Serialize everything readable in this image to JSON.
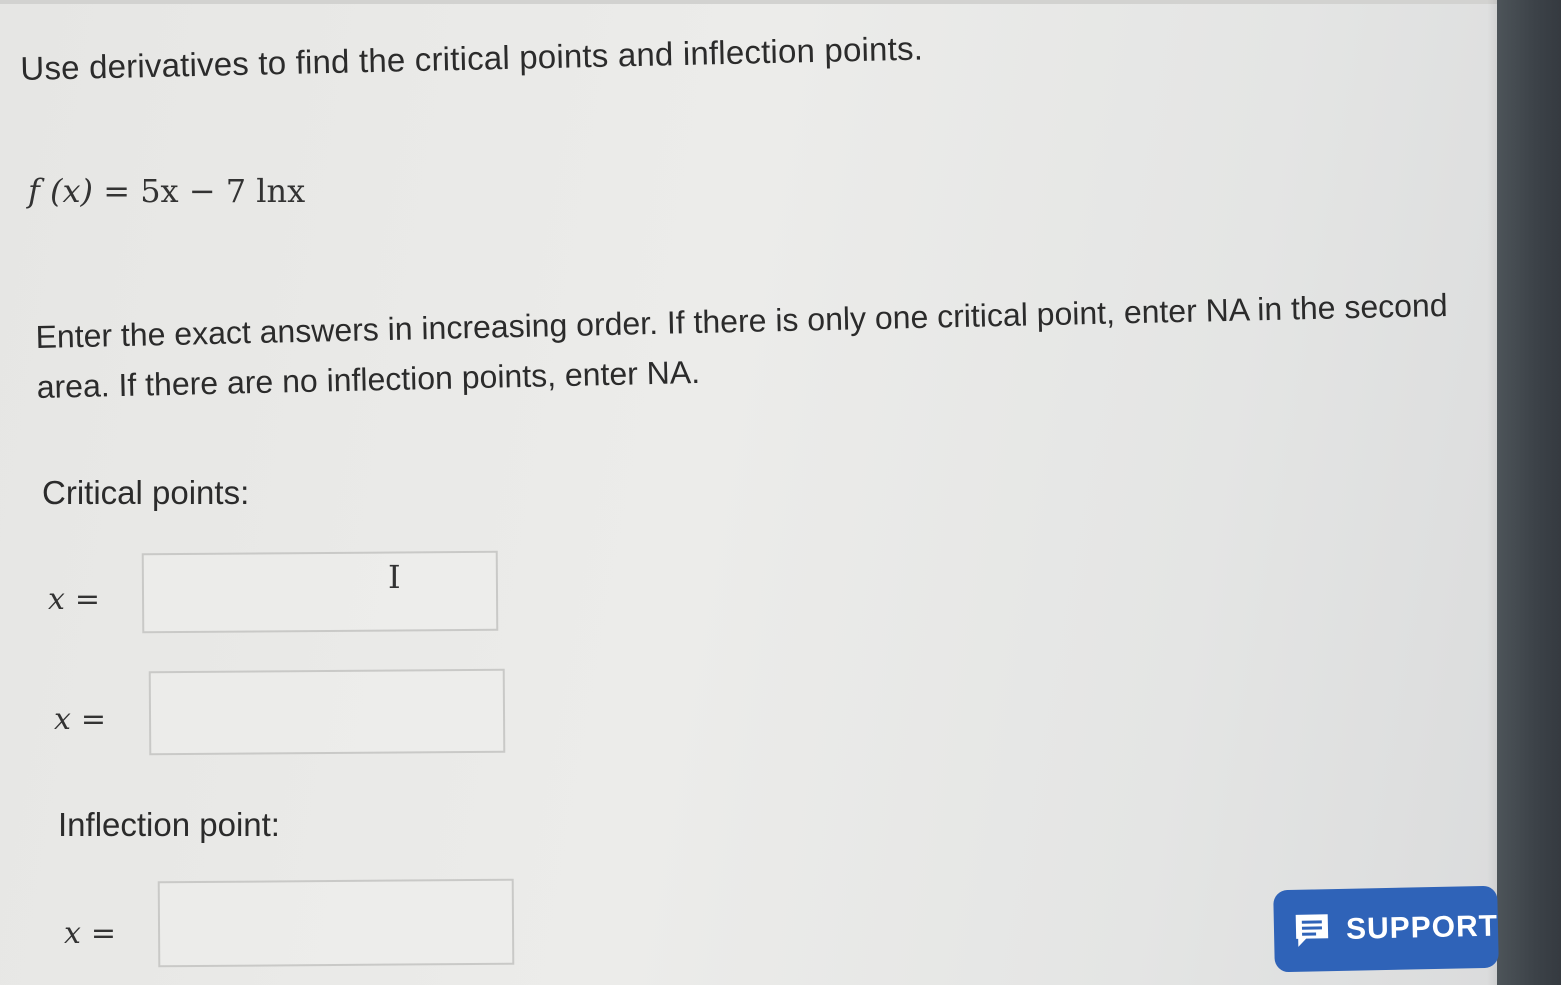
{
  "question": {
    "prompt": "Use derivatives to find the critical points and inflection points.",
    "function_lhs": "f (x)",
    "function_rhs": "= 5x − 7 lnx"
  },
  "instructions": "Enter the exact answers in increasing order. If there is only one critical point, enter NA in the second area. If there are no inflection points, enter NA.",
  "critical_points": {
    "label": "Critical points:",
    "inputs": [
      {
        "var": "x",
        "eq": "=",
        "value": ""
      },
      {
        "var": "x",
        "eq": "=",
        "value": ""
      }
    ]
  },
  "inflection_point": {
    "label": "Inflection point:",
    "inputs": [
      {
        "var": "x",
        "eq": "=",
        "value": ""
      }
    ]
  },
  "support": {
    "label": "SUPPORT",
    "icon": "chat-icon",
    "color": "#2f63b8"
  },
  "cursor": {
    "icon": "text-cursor-icon",
    "glyph": "I"
  }
}
